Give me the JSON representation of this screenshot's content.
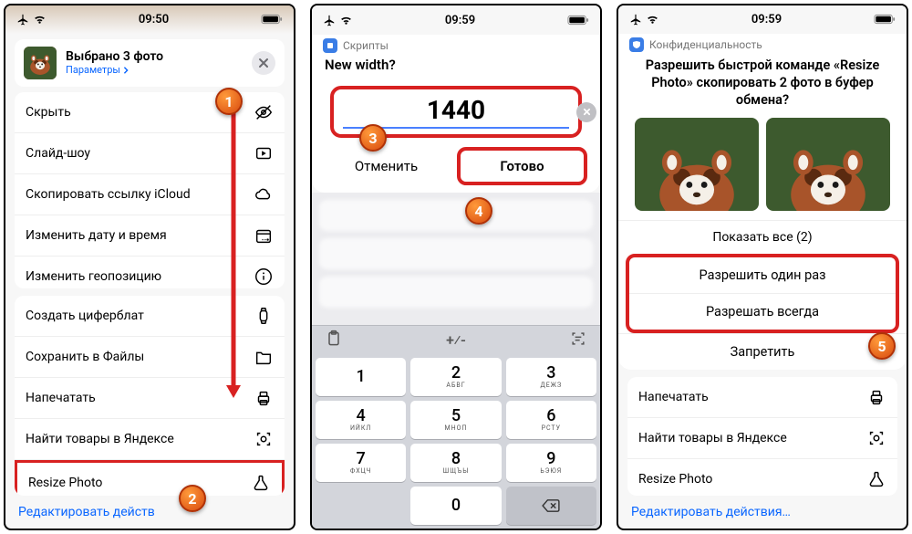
{
  "statusbar": {
    "time1": "09:50",
    "time2": "09:59",
    "time3": "09:59"
  },
  "phone1": {
    "header": {
      "title": "Выбрано 3 фото",
      "params": "Параметры"
    },
    "items": [
      {
        "label": "Скрыть",
        "icon": "eye-slash"
      },
      {
        "label": "Слайд-шоу",
        "icon": "play"
      },
      {
        "label": "Скопировать ссылку iCloud",
        "icon": "cloud"
      },
      {
        "label": "Изменить дату и время",
        "icon": "calendar"
      },
      {
        "label": "Изменить геопозицию",
        "icon": "info"
      }
    ],
    "items2": [
      {
        "label": "Создать циферблат",
        "icon": "watch"
      },
      {
        "label": "Сохранить в Файлы",
        "icon": "folder"
      },
      {
        "label": "Напечатать",
        "icon": "printer"
      },
      {
        "label": "Найти товары в Яндексе",
        "icon": "scan"
      },
      {
        "label": "Resize Photo",
        "icon": "flask"
      }
    ],
    "edit": "Редактировать действ"
  },
  "phone2": {
    "scripts": "Скрипты",
    "question": "New width?",
    "value": "1440",
    "cancel": "Отменить",
    "done": "Готово",
    "keys": [
      {
        "n": "1",
        "l": ""
      },
      {
        "n": "2",
        "l": "АБВГ"
      },
      {
        "n": "3",
        "l": "ДЕЖЗ"
      },
      {
        "n": "4",
        "l": "ИЙКЛ"
      },
      {
        "n": "5",
        "l": "МНОП"
      },
      {
        "n": "6",
        "l": "РСТУ"
      },
      {
        "n": "7",
        "l": "ФХЦЧ"
      },
      {
        "n": "8",
        "l": "ШЩЪЫ"
      },
      {
        "n": "9",
        "l": "ЬЭЮЯ"
      }
    ],
    "zero": "0"
  },
  "phone3": {
    "scripts": "Конфиденциальность",
    "question": "Разрешить быстрой команде «Resize Photo» скопировать 2 фото в буфер обмена?",
    "showall": "Показать все (2)",
    "allow_once": "Разрешить один раз",
    "allow_always": "Разрешать всегда",
    "deny": "Запретить",
    "items": [
      {
        "label": "Напечатать",
        "icon": "printer"
      },
      {
        "label": "Найти товары в Яндексе",
        "icon": "scan"
      },
      {
        "label": "Resize Photo",
        "icon": "flask"
      }
    ],
    "edit": "Редактировать действия…"
  },
  "markers": {
    "m1": "1",
    "m2": "2",
    "m3": "3",
    "m4": "4",
    "m5": "5"
  }
}
